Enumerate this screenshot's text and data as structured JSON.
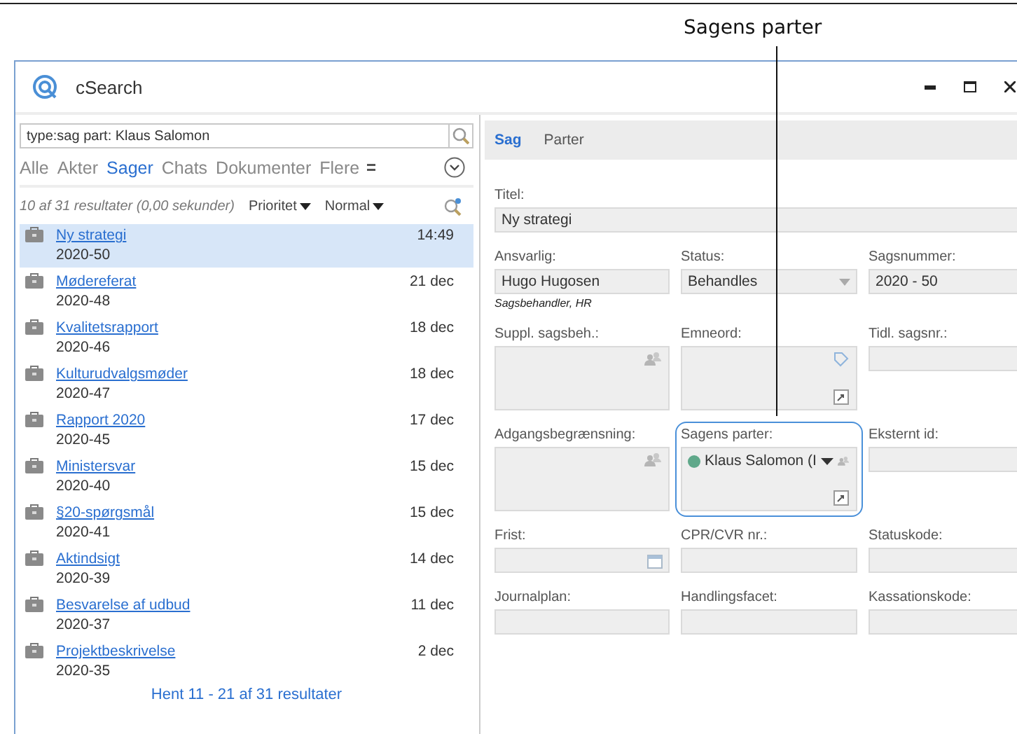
{
  "annotation": {
    "label": "Sagens parter"
  },
  "window": {
    "title": "cSearch"
  },
  "search": {
    "value": "type:sag part: Klaus Salomon"
  },
  "filters": [
    {
      "label": "Alle",
      "selected": false
    },
    {
      "label": "Akter",
      "selected": false
    },
    {
      "label": "Sager",
      "selected": true
    },
    {
      "label": "Chats",
      "selected": false
    },
    {
      "label": "Dokumenter",
      "selected": false
    },
    {
      "label": "Flere",
      "selected": false
    }
  ],
  "results": {
    "summary": "10 af 31 resultater (0,00 sekunder)",
    "sort": "Prioritet",
    "mode": "Normal",
    "more": "Hent 11 - 21 af 31 resultater"
  },
  "items": [
    {
      "title": "Ny strategi",
      "number": "2020-50",
      "date": "14:49",
      "selected": true
    },
    {
      "title": "Mødereferat",
      "number": "2020-48",
      "date": "21 dec",
      "selected": false
    },
    {
      "title": "Kvalitetsrapport",
      "number": "2020-46",
      "date": "18 dec",
      "selected": false
    },
    {
      "title": "Kulturudvalgsmøder",
      "number": "2020-47",
      "date": "18 dec",
      "selected": false
    },
    {
      "title": "Rapport 2020",
      "number": "2020-45",
      "date": "17 dec",
      "selected": false
    },
    {
      "title": "Ministersvar",
      "number": "2020-40",
      "date": "15 dec",
      "selected": false
    },
    {
      "title": "§20-spørgsmål",
      "number": "2020-41",
      "date": "15 dec",
      "selected": false
    },
    {
      "title": "Aktindsigt",
      "number": "2020-39",
      "date": "14 dec",
      "selected": false
    },
    {
      "title": "Besvarelse af udbud",
      "number": "2020-37",
      "date": "11 dec",
      "selected": false
    },
    {
      "title": "Projektbeskrivelse",
      "number": "2020-35",
      "date": "2 dec",
      "selected": false
    }
  ],
  "detail_tabs": [
    {
      "label": "Sag",
      "selected": true
    },
    {
      "label": "Parter",
      "selected": false
    }
  ],
  "fields": [
    {
      "label": "Titel:",
      "kind": "text",
      "value": "Ny strategi",
      "wide": true
    },
    {
      "label": "Ansvarlig:",
      "kind": "text",
      "value": "Hugo Hugosen",
      "note": "Sagsbehandler, HR"
    },
    {
      "label": "Status:",
      "kind": "select",
      "value": "Behandles"
    },
    {
      "label": "Sagsnummer:",
      "kind": "text",
      "value": "2020 - 50"
    },
    {
      "label": "Suppl. sagsbeh.:",
      "kind": "people"
    },
    {
      "label": "Emneord:",
      "kind": "tags"
    },
    {
      "label": "Tidl. sagsnr.:",
      "kind": "text"
    },
    {
      "label": "Adgangsbegrænsning:",
      "kind": "people"
    },
    {
      "label": "Sagens parter:",
      "kind": "parties",
      "highlighted": true,
      "chip": {
        "name": "Klaus Salomon (I",
        "color": "#5fa88a"
      }
    },
    {
      "label": "Eksternt id:",
      "kind": "text"
    },
    {
      "label": "Frist:",
      "kind": "date"
    },
    {
      "label": "CPR/CVR nr.:",
      "kind": "text"
    },
    {
      "label": "Statuskode:",
      "kind": "text"
    },
    {
      "label": "Journalplan:",
      "kind": "text"
    },
    {
      "label": "Handlingsfacet:",
      "kind": "text"
    },
    {
      "label": "Kassationskode:",
      "kind": "text"
    }
  ]
}
